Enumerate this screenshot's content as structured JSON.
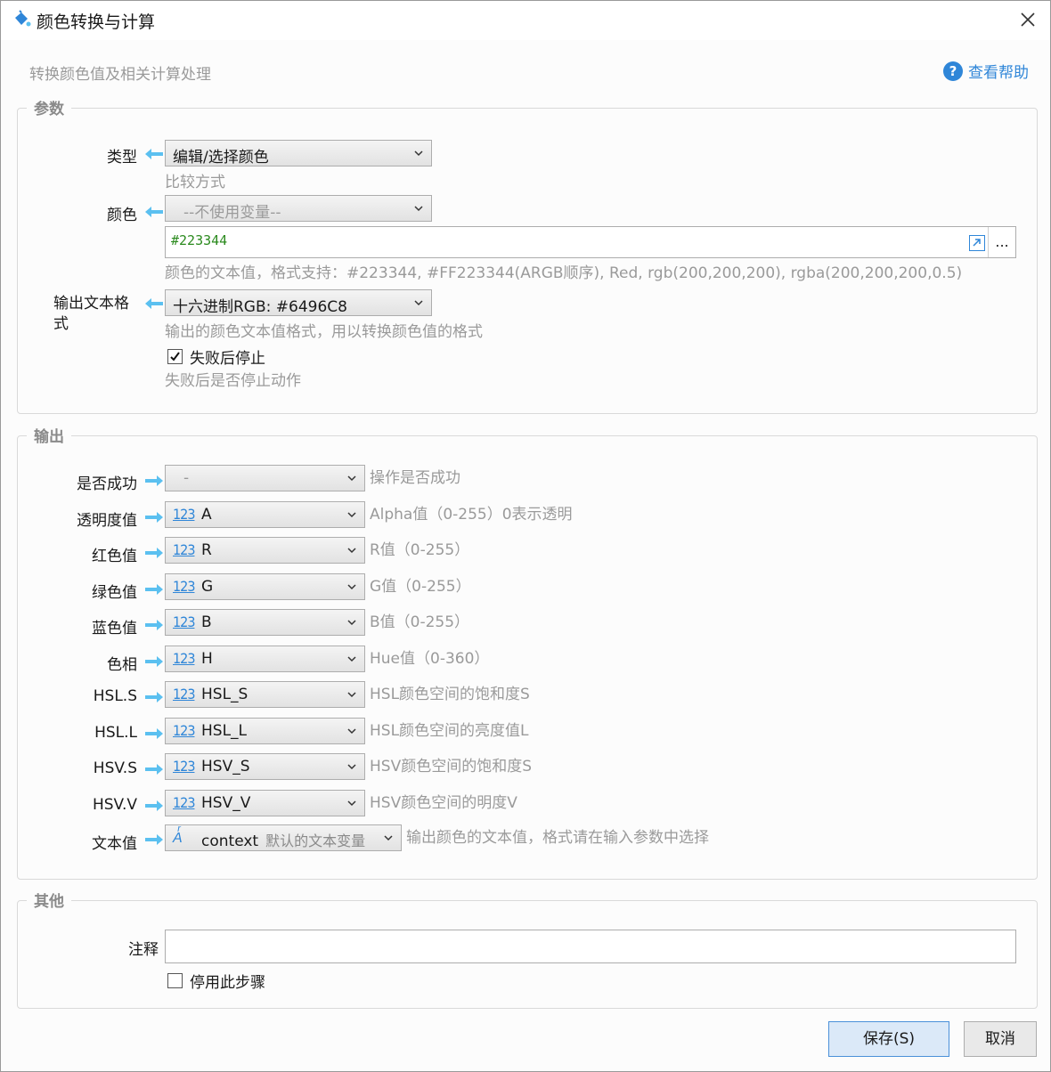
{
  "window": {
    "title": "颜色转换与计算",
    "close_icon": "close-icon"
  },
  "header": {
    "subtitle": "转换颜色值及相关计算处理",
    "help_label": "查看帮助"
  },
  "params": {
    "legend": "参数",
    "type": {
      "label": "类型",
      "value": "编辑/选择颜色",
      "hint": "比较方式"
    },
    "color": {
      "label": "颜色",
      "variable": "--不使用变量--",
      "text_value": "#223344",
      "hint": "颜色的文本值，格式支持：#223344, #FF223344(ARGB顺序), Red, rgb(200,200,200), rgba(200,200,200,0.5)"
    },
    "format": {
      "label": "输出文本格式",
      "value": "十六进制RGB: #6496C8",
      "hint": "输出的颜色文本值格式，用以转换颜色值的格式"
    },
    "stop_on_fail": {
      "label": "失败后停止",
      "checked": true,
      "hint": "失败后是否停止动作"
    }
  },
  "output": {
    "legend": "输出",
    "rows": [
      {
        "label": "是否成功",
        "value": "-",
        "hint": "操作是否成功",
        "disabled": true
      },
      {
        "label": "透明度值",
        "value": "A",
        "hint": "Alpha值（0-255）0表示透明"
      },
      {
        "label": "红色值",
        "value": "R",
        "hint": "R值（0-255）"
      },
      {
        "label": "绿色值",
        "value": "G",
        "hint": "G值（0-255）"
      },
      {
        "label": "蓝色值",
        "value": "B",
        "hint": "B值（0-255）"
      },
      {
        "label": "色相",
        "value": "H",
        "hint": "Hue值（0-360）"
      },
      {
        "label": "HSL.S",
        "value": "HSL_S",
        "hint": "HSL颜色空间的饱和度S"
      },
      {
        "label": "HSL.L",
        "value": "HSL_L",
        "hint": "HSL颜色空间的亮度值L"
      },
      {
        "label": "HSV.S",
        "value": "HSV_S",
        "hint": "HSV颜色空间的饱和度S"
      },
      {
        "label": "HSV.V",
        "value": "HSV_V",
        "hint": "HSV颜色空间的明度V"
      }
    ],
    "num_icon": "123",
    "text": {
      "label": "文本值",
      "value": "context",
      "desc": "默认的文本变量",
      "hint": "输出颜色的文本值，格式请在输入参数中选择"
    }
  },
  "other": {
    "legend": "其他",
    "comment_label": "注释",
    "comment_value": "",
    "disable_step": {
      "label": "停用此步骤",
      "checked": false
    }
  },
  "footer": {
    "save_label": "保存(S)",
    "cancel_label": "取消"
  },
  "colors": {
    "accent": "#2f86d8",
    "arrow": "#5bc0f0",
    "hex_text": "#2b8a1e"
  }
}
